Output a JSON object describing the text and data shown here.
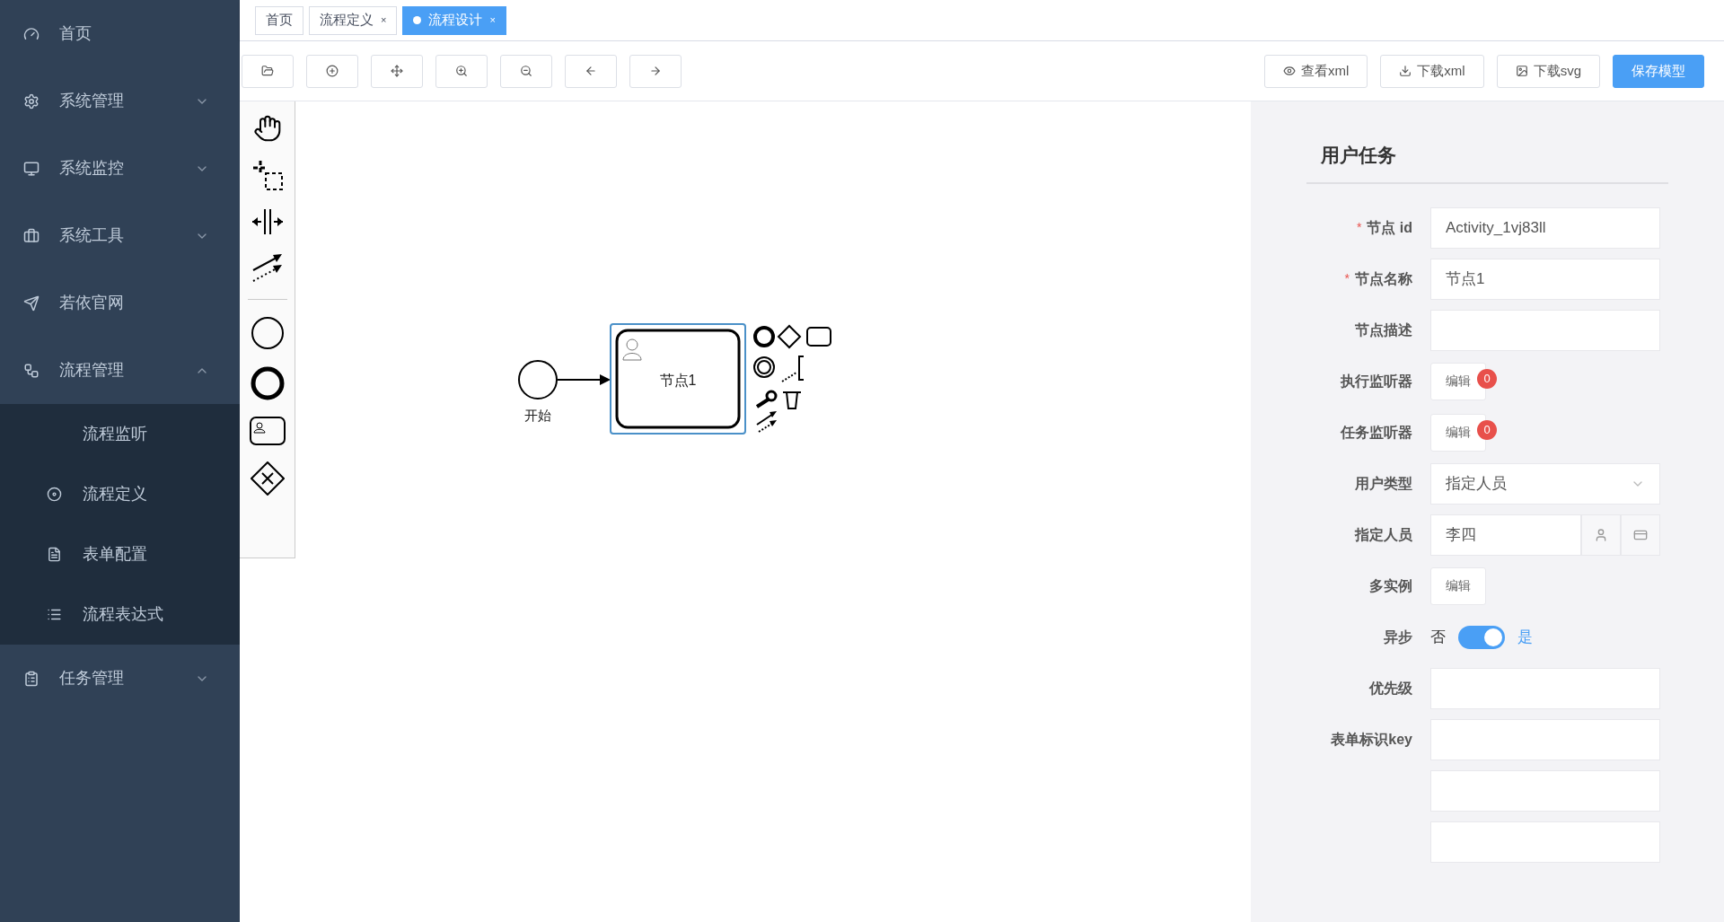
{
  "sidebar": {
    "items": [
      {
        "label": "首页"
      },
      {
        "label": "系统管理",
        "expanded": false
      },
      {
        "label": "系统监控",
        "expanded": false
      },
      {
        "label": "系统工具",
        "expanded": false
      },
      {
        "label": "若依官网"
      },
      {
        "label": "流程管理",
        "expanded": true,
        "children": [
          {
            "label": "流程监听"
          },
          {
            "label": "流程定义"
          },
          {
            "label": "表单配置"
          },
          {
            "label": "流程表达式"
          }
        ]
      },
      {
        "label": "任务管理",
        "expanded": false
      }
    ]
  },
  "tabs": [
    {
      "label": "首页",
      "selected": false
    },
    {
      "label": "流程定义",
      "selected": false,
      "close": "×"
    },
    {
      "label": "流程设计",
      "selected": true,
      "close": "×"
    }
  ],
  "toolbar": {
    "actions": [
      {
        "label": "查看xml",
        "kind": "default"
      },
      {
        "label": "下载xml",
        "kind": "default"
      },
      {
        "label": "下载svg",
        "kind": "default"
      },
      {
        "label": "保存模型",
        "kind": "primary"
      }
    ]
  },
  "diagram": {
    "start_event": {
      "label": "开始"
    },
    "user_task": {
      "label": "节点1",
      "selected": true
    }
  },
  "properties": {
    "title": "用户任务",
    "fields": [
      {
        "kind": "input",
        "label": "节点 id",
        "required_mark": "*",
        "value": "Activity_1vj83ll"
      },
      {
        "kind": "input",
        "label": "节点名称",
        "required_mark": "*",
        "value": "节点1"
      },
      {
        "kind": "input",
        "label": "节点描述"
      },
      {
        "kind": "button",
        "label": "执行监听器",
        "button": "编辑",
        "badge": "0"
      },
      {
        "kind": "button",
        "label": "任务监听器",
        "button": "编辑",
        "badge": "0"
      },
      {
        "kind": "select",
        "label": "用户类型",
        "value": "指定人员"
      },
      {
        "kind": "picker",
        "label": "指定人员",
        "value": "李四"
      },
      {
        "kind": "button",
        "label": "多实例",
        "button": "编辑"
      },
      {
        "kind": "switch",
        "label": "异步",
        "off_label": "否",
        "on_label": "是",
        "on": true
      },
      {
        "kind": "input",
        "label": "优先级"
      },
      {
        "kind": "input",
        "label": "表单标识key"
      },
      {
        "kind": "input"
      },
      {
        "kind": "input"
      }
    ]
  }
}
